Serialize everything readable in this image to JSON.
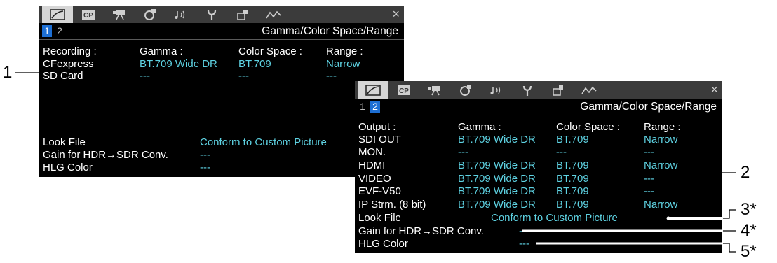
{
  "tabs": [
    {
      "icon": "gamma-curve-icon"
    },
    {
      "icon": "custom-picture-icon",
      "text": "CP"
    },
    {
      "icon": "camera-icon"
    },
    {
      "icon": "record-settings-icon"
    },
    {
      "icon": "audio-icon"
    },
    {
      "icon": "wrench-icon"
    },
    {
      "icon": "assign-icon"
    },
    {
      "icon": "network-icon"
    }
  ],
  "close_icon": "×",
  "screen1": {
    "pages": [
      "1",
      "2"
    ],
    "active_page": "1",
    "title": "Gamma/Color Space/Range",
    "headers": [
      "Recording :",
      "Gamma :",
      "Color Space :",
      "Range :"
    ],
    "rows": [
      {
        "name": "CFexpress",
        "gamma": "BT.709 Wide DR",
        "color_space": "BT.709",
        "range": "Narrow"
      },
      {
        "name": "SD Card",
        "gamma": "---",
        "color_space": "---",
        "range": "---"
      }
    ],
    "look_file_label": "Look File",
    "look_file_value": "Conform to Custom Picture",
    "gain_label": "Gain for HDR→SDR Conv.",
    "gain_value": "---",
    "hlg_label": "HLG Color",
    "hlg_value": "---"
  },
  "screen2": {
    "pages": [
      "1",
      "2"
    ],
    "active_page": "2",
    "title": "Gamma/Color Space/Range",
    "headers": [
      "Output :",
      "Gamma :",
      "Color Space :",
      "Range :"
    ],
    "rows": [
      {
        "name": "SDI OUT",
        "gamma": "BT.709 Wide DR",
        "color_space": "BT.709",
        "range": "Narrow"
      },
      {
        "name": "MON.",
        "gamma": "---",
        "color_space": "---",
        "range": "---"
      },
      {
        "name": "HDMI",
        "gamma": "BT.709 Wide DR",
        "color_space": "BT.709",
        "range": "Narrow"
      },
      {
        "name": "VIDEO",
        "gamma": "BT.709 Wide DR",
        "color_space": "BT.709",
        "range": "---"
      },
      {
        "name": "EVF-V50",
        "gamma": "BT.709 Wide DR",
        "color_space": "BT.709",
        "range": "---"
      },
      {
        "name": "IP Strm. (8 bit)",
        "gamma": "BT.709 Wide DR",
        "color_space": "BT.709",
        "range": "Narrow"
      }
    ],
    "look_file_label": "Look File",
    "look_file_value": "Conform to Custom Picture",
    "gain_label": "Gain for HDR→SDR Conv.",
    "gain_value": "---",
    "hlg_label": "HLG Color",
    "hlg_value": "---"
  },
  "callouts": [
    "1",
    "2",
    "3*",
    "4*",
    "5*"
  ],
  "colors": {
    "value_cyan": "#5ed2e2",
    "active_page_blue": "#1d6fd4",
    "tab_bar": "#3b3b3b"
  }
}
